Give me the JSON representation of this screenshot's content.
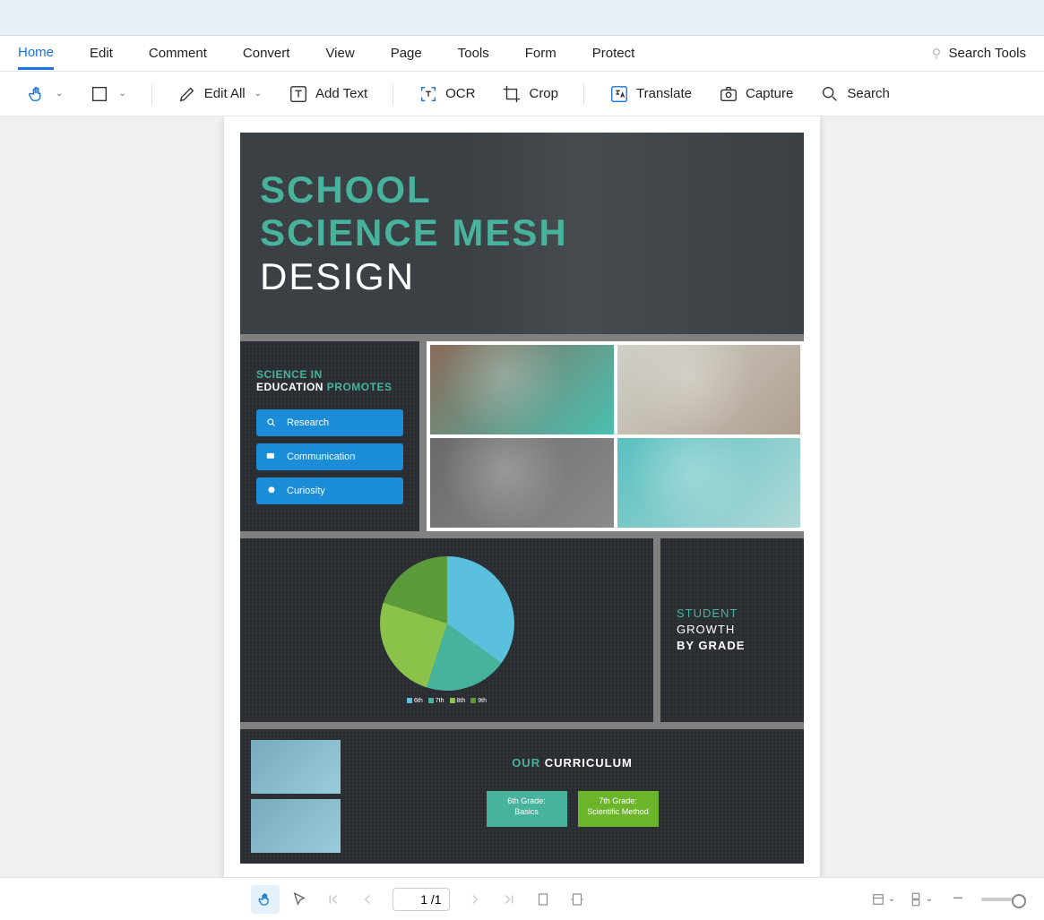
{
  "menu": {
    "tabs": [
      "Home",
      "Edit",
      "Comment",
      "Convert",
      "View",
      "Page",
      "Tools",
      "Form",
      "Protect"
    ],
    "active_index": 0,
    "search_placeholder": "Search Tools"
  },
  "toolbar": {
    "edit_all": "Edit All",
    "add_text": "Add Text",
    "ocr": "OCR",
    "crop": "Crop",
    "translate": "Translate",
    "capture": "Capture",
    "search": "Search"
  },
  "document": {
    "header": {
      "line1": "SCHOOL",
      "line2": "SCIENCE MESH",
      "line3": "DESIGN"
    },
    "promotes": {
      "title_a": "SCIENCE IN",
      "title_b": "EDUCATION ",
      "title_c": "PROMOTES",
      "items": [
        "Research",
        "Communication",
        "Curiosity"
      ]
    },
    "growth": {
      "l1": "STUDENT",
      "l2": "GROWTH",
      "l3": "BY GRADE"
    },
    "pie_legend": [
      "6th",
      "7th",
      "8th",
      "9th"
    ],
    "curriculum": {
      "title_a": "OUR ",
      "title_b": "CURRICULUM",
      "cards": [
        {
          "line1": "6th Grade:",
          "line2": "Basics"
        },
        {
          "line1": "7th Grade:",
          "line2": "Scientific Method"
        }
      ]
    }
  },
  "chart_data": {
    "type": "pie",
    "title": "Student Growth by Grade",
    "categories": [
      "6th",
      "7th",
      "8th",
      "9th"
    ],
    "values": [
      35,
      20,
      25,
      20
    ],
    "colors": [
      "#5bc0de",
      "#47b39c",
      "#8bc34a",
      "#5a9a3a"
    ]
  },
  "footer": {
    "current_page": "1",
    "total_pages": "1"
  }
}
